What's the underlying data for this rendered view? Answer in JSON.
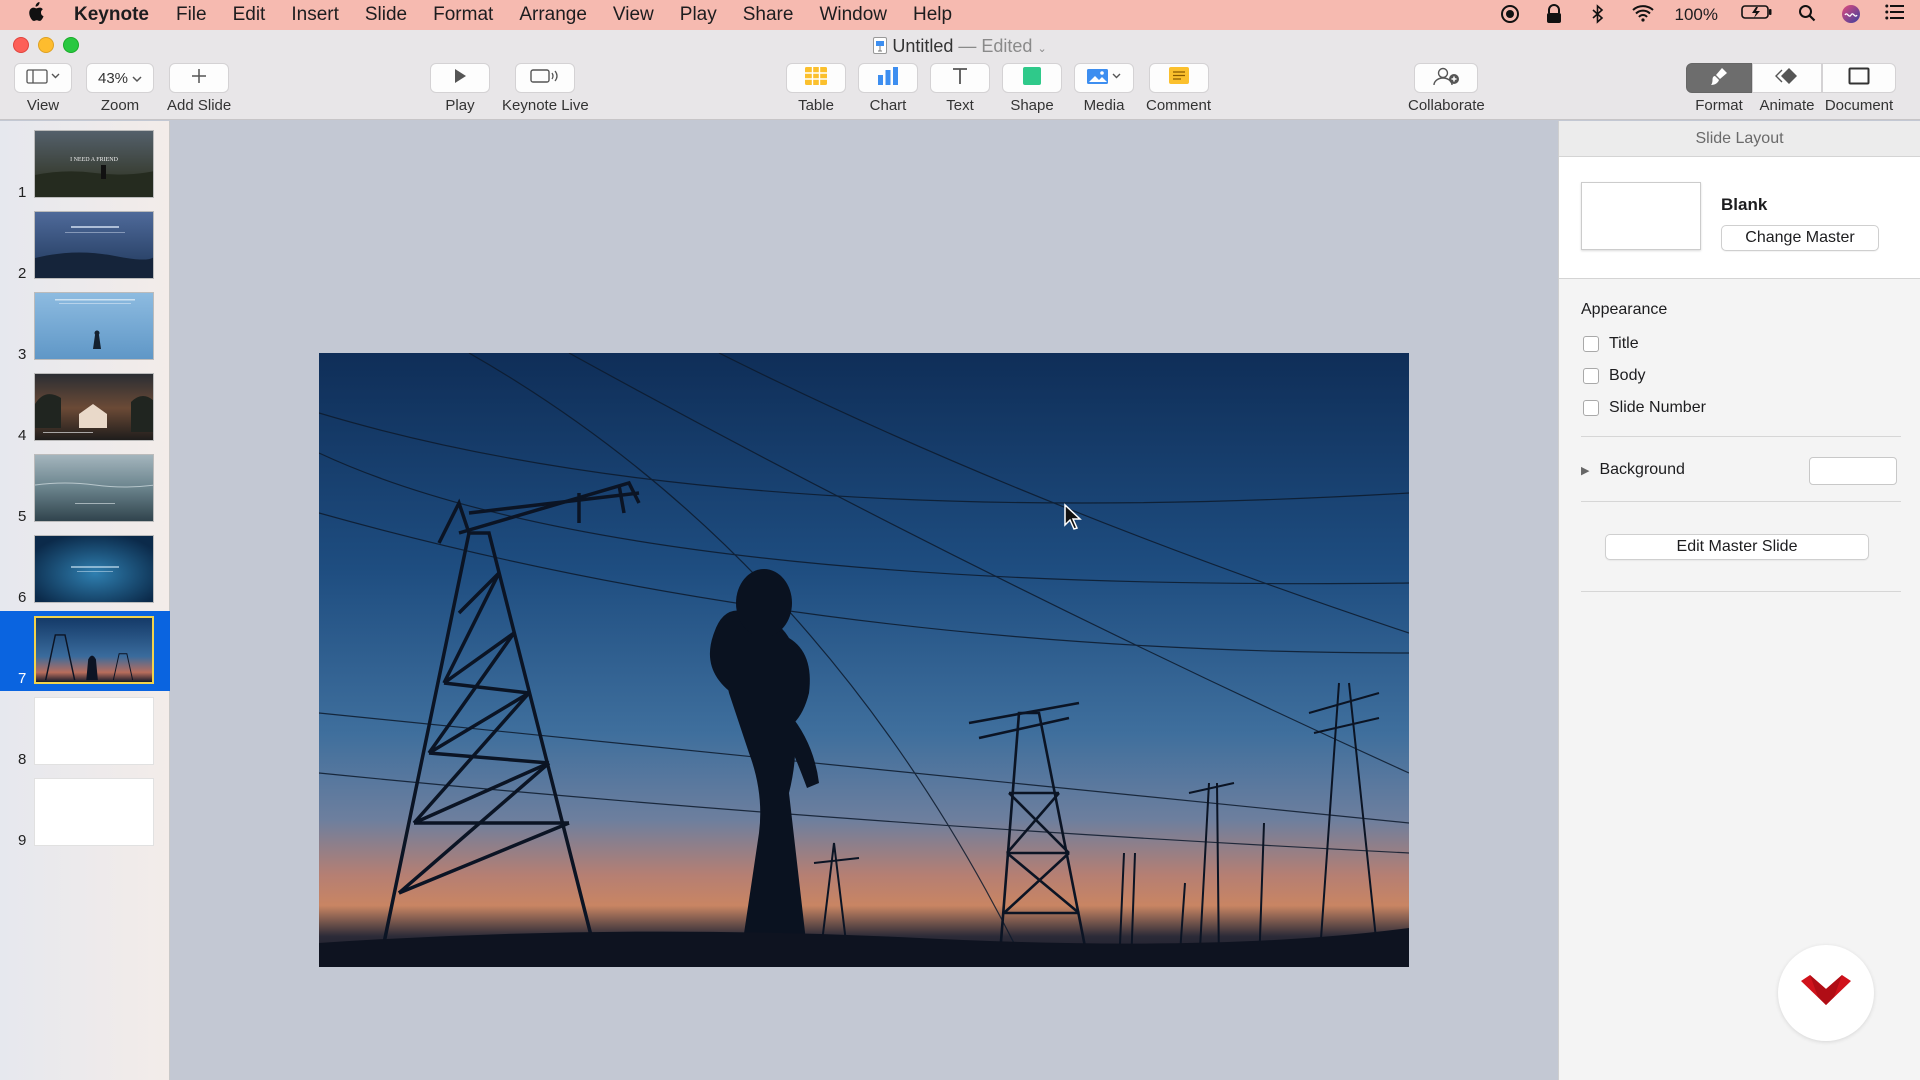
{
  "menubar": {
    "app_name": "Keynote",
    "items": [
      "File",
      "Edit",
      "Insert",
      "Slide",
      "Format",
      "Arrange",
      "View",
      "Play",
      "Share",
      "Window",
      "Help"
    ],
    "battery": "100%"
  },
  "window": {
    "title": "Untitled",
    "status": "— Edited"
  },
  "toolbar": {
    "view_label": "View",
    "zoom_value": "43%",
    "zoom_label": "Zoom",
    "add_slide_label": "Add Slide",
    "play_label": "Play",
    "keynote_live_label": "Keynote Live",
    "table_label": "Table",
    "chart_label": "Chart",
    "text_label": "Text",
    "shape_label": "Shape",
    "media_label": "Media",
    "comment_label": "Comment",
    "collaborate_label": "Collaborate",
    "format_label": "Format",
    "animate_label": "Animate",
    "document_label": "Document"
  },
  "navigator": {
    "slides": [
      {
        "num": "1",
        "caption": "I NEED A FRIEND",
        "style": "dark-field"
      },
      {
        "num": "2",
        "caption": "",
        "style": "blue-hill"
      },
      {
        "num": "3",
        "caption": "",
        "style": "light-blue-figure"
      },
      {
        "num": "4",
        "caption": "",
        "style": "sunset-house"
      },
      {
        "num": "5",
        "caption": "",
        "style": "sea-fog"
      },
      {
        "num": "6",
        "caption": "",
        "style": "deep-blue"
      },
      {
        "num": "7",
        "caption": "",
        "style": "power-lines"
      },
      {
        "num": "8",
        "caption": "",
        "style": "blank"
      },
      {
        "num": "9",
        "caption": "",
        "style": "blank"
      }
    ],
    "selected": "7"
  },
  "inspector": {
    "header": "Slide Layout",
    "layout_name": "Blank",
    "change_master": "Change Master",
    "appearance": "Appearance",
    "options": [
      {
        "label": "Title",
        "checked": false
      },
      {
        "label": "Body",
        "checked": false
      },
      {
        "label": "Slide Number",
        "checked": false
      }
    ],
    "background": "Background",
    "edit_master": "Edit Master Slide"
  },
  "colors": {
    "menubar": "#f6bab0",
    "selection": "#0a64e0",
    "thumb_border_selected": "#f2d34c",
    "logo_red": "#d0121b"
  }
}
